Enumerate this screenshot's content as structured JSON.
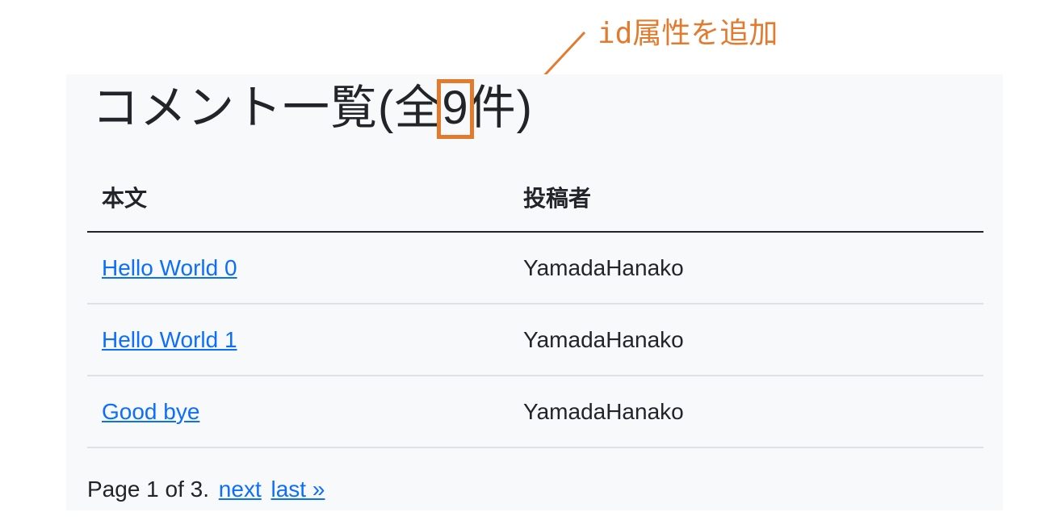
{
  "page": {
    "title_prefix": "コメント一覧(全",
    "count": "9",
    "title_suffix": "件)"
  },
  "table": {
    "headers": [
      "本文",
      "投稿者"
    ],
    "rows": [
      {
        "body": "Hello World 0",
        "author": "YamadaHanako"
      },
      {
        "body": "Hello World 1",
        "author": "YamadaHanako"
      },
      {
        "body": "Good bye",
        "author": "YamadaHanako"
      }
    ]
  },
  "pagination": {
    "text": "Page 1 of 3.",
    "next_label": "next",
    "last_label": "last »"
  },
  "annotation": {
    "label": "id属性を追加",
    "color": "#e37b2f"
  }
}
